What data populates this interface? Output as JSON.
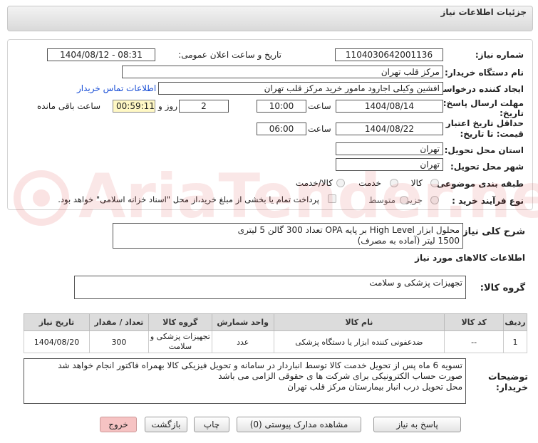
{
  "header": {
    "title": "جزئیات اطلاعات نیاز"
  },
  "fields": {
    "need_number_label": "شماره نیاز:",
    "need_number": "1104030642001136",
    "announce_label": "تاریخ و ساعت اعلان عمومی:",
    "announce_value": "1404/08/12 - 08:31",
    "buyer_label": "نام دستگاه خریدار:",
    "buyer_value": "مرکز قلب تهران",
    "creator_label": "ایجاد کننده درخواست:",
    "creator_value": "افشین وکیلی اجارود مامور خرید مرکز قلب تهران",
    "contact_link": "اطلاعات تماس خریدار",
    "deadline_label_1": "مهلت ارسال پاسخ: تا",
    "deadline_label_2": "تاریخ:",
    "deadline_date": "1404/08/14",
    "time_label": "ساعت",
    "deadline_time": "10:00",
    "days_value": "2",
    "days_label": "روز و",
    "remaining_time": "00:59:11",
    "remaining_label": "ساعت باقی مانده",
    "validity_label_1": "حداقل تاریخ اعتبار",
    "validity_label_2": "قیمت: تا تاریخ:",
    "validity_date": "1404/08/22",
    "validity_time": "06:00",
    "province_label": "استان محل تحویل:",
    "province_value": "تهران",
    "city_label": "شهر محل تحویل:",
    "city_value": "تهران",
    "category_label": "طبقه بندی موضوعی:",
    "category_options": [
      "کالا",
      "خدمت",
      "کالا/خدمت"
    ],
    "process_label": "نوع فرآیند خرید :",
    "process_options": [
      "جزیی",
      "متوسط"
    ],
    "payment_note": "پرداخت تمام یا بخشی از مبلغ خرید،از محل \"اسناد خزانه اسلامی\" خواهد بود."
  },
  "summary": {
    "label": "شرح کلی نیاز:",
    "text_line1": "محلول ابزار High Level بر پایه OPA تعداد 300 گالن 5 لیتری",
    "text_line2": "1500 لیتر (آماده به مصرف)"
  },
  "goods": {
    "section_title": "اطلاعات کالاهای مورد نیاز",
    "group_label": "گروه کالا:",
    "group_value": "تجهیزات پزشکی و سلامت"
  },
  "table": {
    "headers": [
      "ردیف",
      "کد کالا",
      "نام کالا",
      "واحد شمارش",
      "گروه کالا",
      "تعداد / مقدار",
      "تاریخ نیاز"
    ],
    "rows": [
      {
        "index": "1",
        "code": "--",
        "name": "ضدعفونی کننده ابزار یا دستگاه پزشکی",
        "unit": "عدد",
        "group_line1": "تجهیزات پزشکی و",
        "group_line2": "سلامت",
        "qty": "300",
        "date": "1404/08/20"
      }
    ]
  },
  "notes": {
    "label_1": "توضیحات",
    "label_2": "خریدار:",
    "line1": "تسویه 6 ماه پس از تحویل خدمت کالا توسط انباردار در سامانه و تحویل فیزیکی کالا بهمراه فاکتور انجام خواهد شد",
    "line2": "صورت حساب الکترونیکی برای شرکت ها ی حقوقی الزامی می باشد",
    "line3": "محل تحویل درب انبار بیمارستان مرکز قلب تهران"
  },
  "buttons": {
    "reply": "پاسخ به نیاز",
    "attachments": "مشاهده مدارک پیوستی (0)",
    "print": "چاپ",
    "back": "بازگشت",
    "exit": "خروج"
  },
  "watermark": {
    "text": "AriaTender.neT"
  },
  "colors": {
    "accent_link": "#1a4fd6",
    "highlight": "#fff8c4",
    "exit_button": "#f6c3c3"
  }
}
